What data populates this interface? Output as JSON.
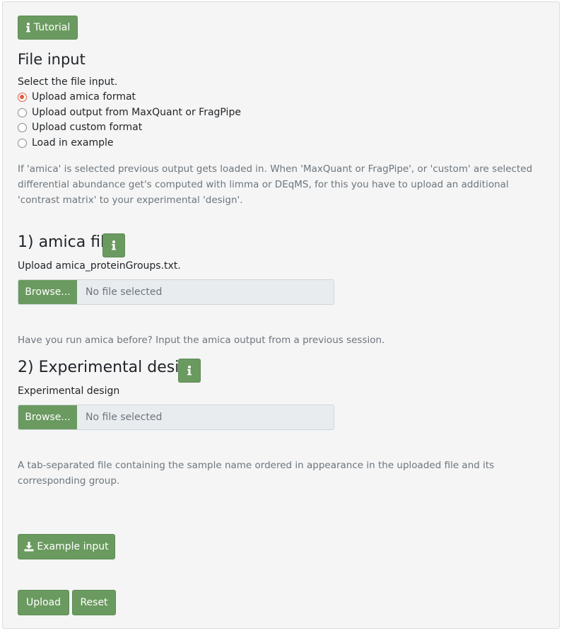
{
  "tutorial_button": {
    "icon": "info-icon",
    "label": "Tutorial"
  },
  "file_input": {
    "heading": "File input",
    "prompt": "Select the file input.",
    "options": [
      {
        "label": "Upload amica format",
        "checked": true
      },
      {
        "label": "Upload output from MaxQuant or FragPipe",
        "checked": false
      },
      {
        "label": "Upload custom format",
        "checked": false
      },
      {
        "label": "Load in example",
        "checked": false
      }
    ],
    "help": "If 'amica' is selected previous output gets loaded in. When 'MaxQuant or FragPipe', or 'custom' are selected differential abundance get's computed with limma or DEqMS, for this you have to upload an additional 'contrast matrix' to your experimental 'design'."
  },
  "amica_file": {
    "heading": "1) amica file",
    "label": "Upload amica_proteinGroups.txt.",
    "browse_label": "Browse...",
    "placeholder": "No file selected",
    "help": "Have you run amica before? Input the amica output from a previous session."
  },
  "design": {
    "heading": "2) Experimental design",
    "label": "Experimental design",
    "browse_label": "Browse...",
    "placeholder": "No file selected",
    "help": "A tab-separated file containing the sample name ordered in appearance in the uploaded file and its corresponding group."
  },
  "example_button": {
    "icon": "download-icon",
    "label": "Example input"
  },
  "upload_button": {
    "label": "Upload"
  },
  "reset_button": {
    "label": "Reset"
  },
  "colors": {
    "accent": "#6a9a5f",
    "radio_checked": "#e05a3a",
    "panel_bg": "#f5f5f5"
  }
}
